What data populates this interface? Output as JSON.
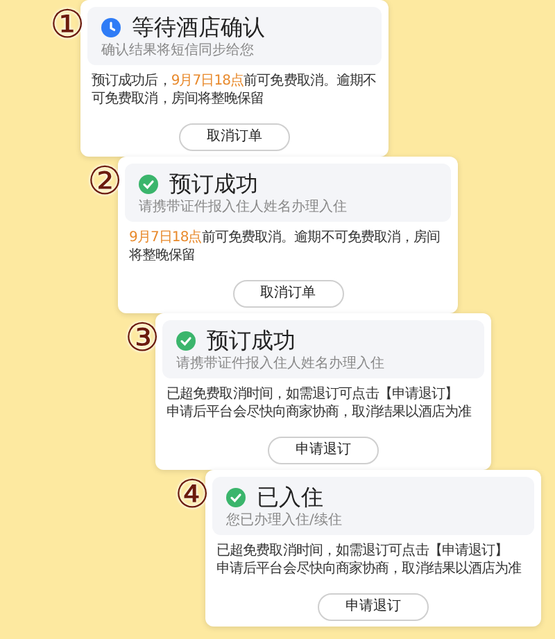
{
  "cards": [
    {
      "number": "①",
      "confirmed": false,
      "title": "等待酒店确认",
      "subtitle": "确认结果将短信同步给您",
      "body": [
        [
          {
            "text": "预订成功后，",
            "highlighted": false
          },
          {
            "text": "9月7日18点",
            "highlighted": true
          },
          {
            "text": "前可免费取消。逾期不可免费取消，房间将整晚保留",
            "highlighted": false
          }
        ]
      ],
      "button": "取消订单"
    },
    {
      "number": "②",
      "confirmed": true,
      "title": "预订成功",
      "subtitle": "请携带证件报入住人姓名办理入住",
      "body": [
        [
          {
            "text": "9月7日18点",
            "highlighted": true
          },
          {
            "text": "前可免费取消。逾期不可免费取消，房间将整晚保留",
            "highlighted": false
          }
        ]
      ],
      "button": "取消订单"
    },
    {
      "number": "③",
      "confirmed": true,
      "title": "预订成功",
      "subtitle": "请携带证件报入住人姓名办理入住",
      "body": [
        [
          {
            "text": "已超免费取消时间，如需退订可点击【申请退订】",
            "highlighted": false
          }
        ],
        [
          {
            "text": "申请后平台会尽快向商家协商，取消结果以酒店为准",
            "highlighted": false
          }
        ]
      ],
      "button": "申请退订"
    },
    {
      "number": "④",
      "confirmed": true,
      "title": "已入住",
      "subtitle": "您已办理入住/续住",
      "body": [
        [
          {
            "text": "已超免费取消时间，如需退订可点击【申请退订】",
            "highlighted": false
          }
        ],
        [
          {
            "text": "申请后平台会尽快向商家协商，取消结果以酒店为准",
            "highlighted": false
          }
        ]
      ],
      "button": "申请退订"
    }
  ]
}
